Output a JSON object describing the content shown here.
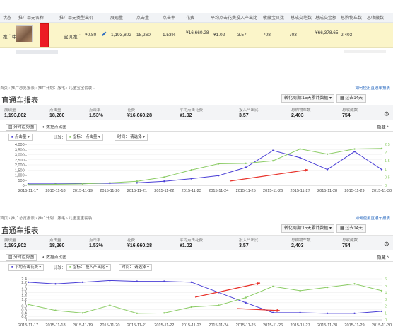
{
  "table": {
    "headers": [
      "状态",
      "推广单元名称",
      "推广单元类型",
      "出价",
      "展现量",
      "点击量",
      "点击率",
      "花费",
      "平均点击花费",
      "投入产出比",
      "收藏宝贝数",
      "总成交笔数",
      "总成交金额",
      "总购物车数",
      "总收藏数"
    ],
    "row": {
      "status": "推广中",
      "unit_type": "宝贝推广",
      "bid": "¥0.80",
      "impressions": "1,193,802",
      "clicks": "18,260",
      "ctr": "1.53%",
      "cost": "¥16,660.28",
      "cpc": "¥1.02",
      "roi": "3.57",
      "favorites": "708",
      "orders": "703",
      "gmv": "¥66,378.65",
      "cart": "2,403"
    }
  },
  "report": {
    "breadcrumb": [
      "首页",
      "推广总览报表",
      "推广计划：服毛",
      "儿童宝宝套装…"
    ],
    "help": "如何使用直通车报表",
    "title": "直通车报表",
    "period_label": "转化周期:15天累计数据",
    "range_label": "过去14天",
    "summary": [
      {
        "k": "展现量",
        "v": "1,193,802"
      },
      {
        "k": "点击量",
        "v": "18,260"
      },
      {
        "k": "点击率",
        "v": "1.53%"
      },
      {
        "k": "花费",
        "v": "¥16,660.28"
      },
      {
        "k": "平均点击花费",
        "v": "¥1.02"
      },
      {
        "k": "投入产出比",
        "v": "3.57"
      },
      {
        "k": "总购物车数",
        "v": "2,403"
      },
      {
        "k": "总收藏数",
        "v": "754"
      }
    ],
    "tab_trend": "分时趋势图",
    "tab_data": "数据点比图",
    "hide": "隐藏",
    "compare_label": "比较：",
    "indicator_label": "指标：",
    "time_label": "时间：",
    "time_value": "请选择"
  },
  "chart1": {
    "metric_a": "点击量",
    "metric_b": "点击量"
  },
  "chart2": {
    "metric_a": "平均点击花费",
    "metric_b": "投入产出比"
  },
  "colors": {
    "blue": "#4a3fd6",
    "green": "#8ccc66",
    "red": "#e8322a",
    "accent": "#2a6ac0"
  },
  "chart_data": [
    {
      "type": "line",
      "x": [
        "2015-11-17",
        "2015-11-18",
        "2015-11-19",
        "2015-11-20",
        "2015-11-21",
        "2015-11-22",
        "2015-11-23",
        "2015-11-24",
        "2015-11-25",
        "2015-11-26",
        "2015-11-27",
        "2015-11-28",
        "2015-11-29",
        "2015-11-30"
      ],
      "ylim": [
        0,
        4000
      ],
      "yticks": [
        "4,000 -",
        "3,500 -",
        "3,000 -",
        "2,500 -",
        "2,000 -",
        "1,500 -",
        "1,000 -",
        "500 -",
        "0 -"
      ],
      "y2ticks": [
        "2.5",
        "2",
        "1.5",
        "1",
        "0.5",
        "0"
      ],
      "series": [
        {
          "values": [
            150,
            150,
            180,
            200,
            250,
            400,
            650,
            950,
            1750,
            3400,
            2700,
            1550,
            3300,
            1550
          ]
        },
        {
          "values": [
            80,
            100,
            150,
            250,
            400,
            800,
            1500,
            2100,
            2150,
            2400,
            3550,
            3050,
            3550,
            3600
          ]
        }
      ]
    },
    {
      "type": "line",
      "x": [
        "2015-11-17",
        "2015-11-18",
        "2015-11-19",
        "2015-11-20",
        "2015-11-21",
        "2015-11-22",
        "2015-11-23",
        "2015-11-24",
        "2015-11-25",
        "2015-11-26",
        "2015-11-27",
        "2015-11-28",
        "2015-11-29",
        "2015-11-30"
      ],
      "ylim": [
        0,
        2.4
      ],
      "yticks": [
        "2.4",
        "2.2",
        "2",
        "1.8",
        "1.6",
        "1.4",
        "1.2",
        "1",
        "0.8",
        "0.6",
        "0.4",
        "0.2",
        "0"
      ],
      "y2ticks": [
        "6",
        "5",
        "4",
        "3",
        "2",
        "1",
        "0"
      ],
      "series": [
        {
          "values": [
            2.2,
            2.1,
            2.2,
            2.3,
            2.25,
            2.25,
            2.2,
            1.6,
            1.0,
            0.42,
            0.42,
            0.38,
            0.38,
            0.5
          ]
        },
        {
          "values": [
            0.9,
            0.55,
            0.4,
            0.85,
            0.38,
            0.4,
            0.75,
            0.85,
            1.3,
            1.95,
            1.7,
            1.9,
            2.1,
            1.7
          ]
        }
      ]
    }
  ]
}
